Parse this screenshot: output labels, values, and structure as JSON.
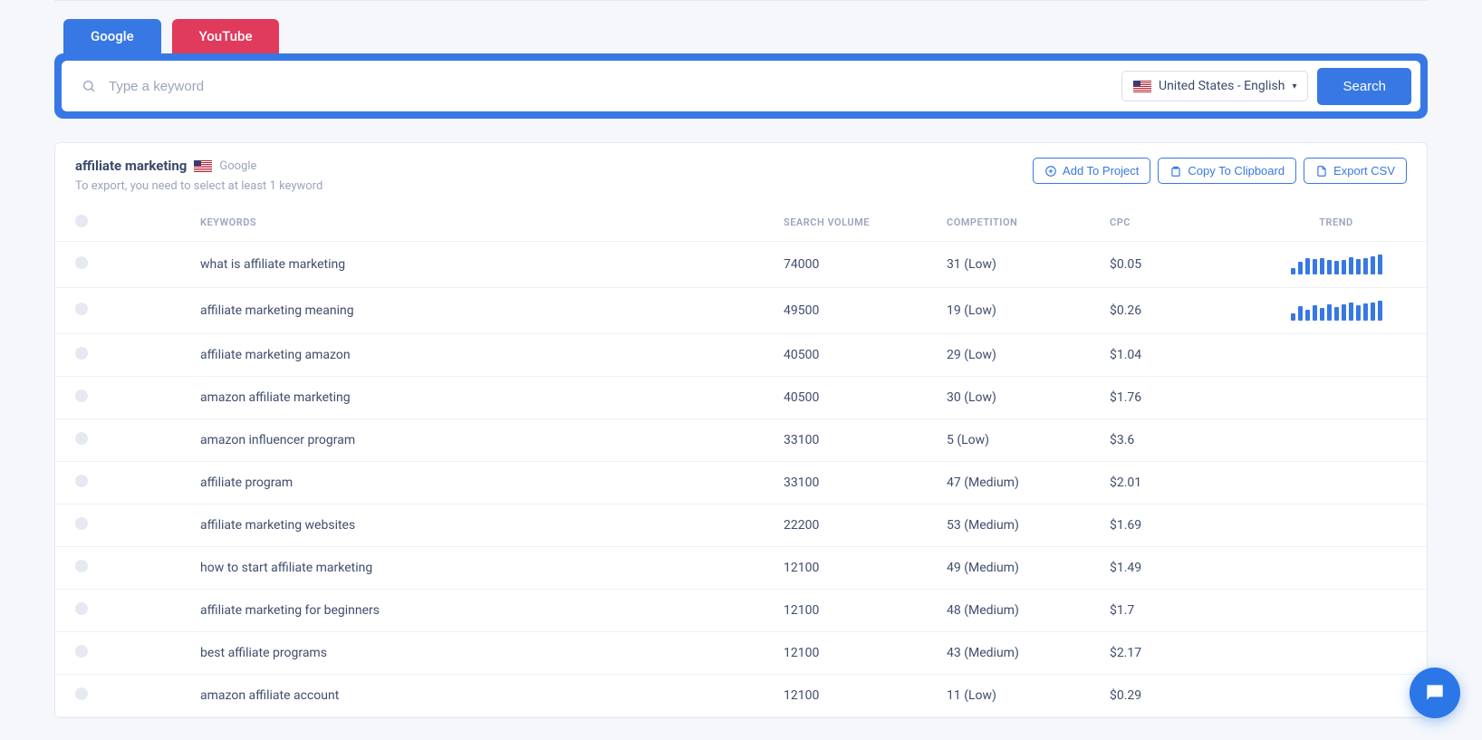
{
  "tabs": {
    "google": "Google",
    "youtube": "YouTube"
  },
  "search": {
    "placeholder": "Type a keyword",
    "locale": "United States - English",
    "button": "Search"
  },
  "results": {
    "query": "affiliate marketing",
    "source": "Google",
    "note": "To export, you need to select at least 1 keyword",
    "actions": {
      "add_project": "Add To Project",
      "copy_clipboard": "Copy To Clipboard",
      "export_csv": "Export CSV"
    },
    "columns": {
      "keywords": "Keywords",
      "volume": "Search Volume",
      "competition": "Competition",
      "cpc": "CPC",
      "trend": "Trend"
    },
    "rows": [
      {
        "keyword": "what is affiliate marketing",
        "volume": "74000",
        "competition": "31 (Low)",
        "cpc": "$0.05",
        "trend": [
          7,
          14,
          18,
          17,
          18,
          16,
          15,
          16,
          19,
          17,
          18,
          20,
          22
        ]
      },
      {
        "keyword": "affiliate marketing meaning",
        "volume": "49500",
        "competition": "19 (Low)",
        "cpc": "$0.26",
        "trend": [
          8,
          16,
          12,
          17,
          14,
          18,
          15,
          18,
          20,
          17,
          19,
          20,
          22
        ]
      },
      {
        "keyword": "affiliate marketing amazon",
        "volume": "40500",
        "competition": "29 (Low)",
        "cpc": "$1.04",
        "trend": null
      },
      {
        "keyword": "amazon affiliate marketing",
        "volume": "40500",
        "competition": "30 (Low)",
        "cpc": "$1.76",
        "trend": null
      },
      {
        "keyword": "amazon influencer program",
        "volume": "33100",
        "competition": "5 (Low)",
        "cpc": "$3.6",
        "trend": null
      },
      {
        "keyword": "affiliate program",
        "volume": "33100",
        "competition": "47 (Medium)",
        "cpc": "$2.01",
        "trend": null
      },
      {
        "keyword": "affiliate marketing websites",
        "volume": "22200",
        "competition": "53 (Medium)",
        "cpc": "$1.69",
        "trend": null
      },
      {
        "keyword": "how to start affiliate marketing",
        "volume": "12100",
        "competition": "49 (Medium)",
        "cpc": "$1.49",
        "trend": null
      },
      {
        "keyword": "affiliate marketing for beginners",
        "volume": "12100",
        "competition": "48 (Medium)",
        "cpc": "$1.7",
        "trend": null
      },
      {
        "keyword": "best affiliate programs",
        "volume": "12100",
        "competition": "43 (Medium)",
        "cpc": "$2.17",
        "trend": null
      },
      {
        "keyword": "amazon affiliate account",
        "volume": "12100",
        "competition": "11 (Low)",
        "cpc": "$0.29",
        "trend": null
      }
    ]
  }
}
